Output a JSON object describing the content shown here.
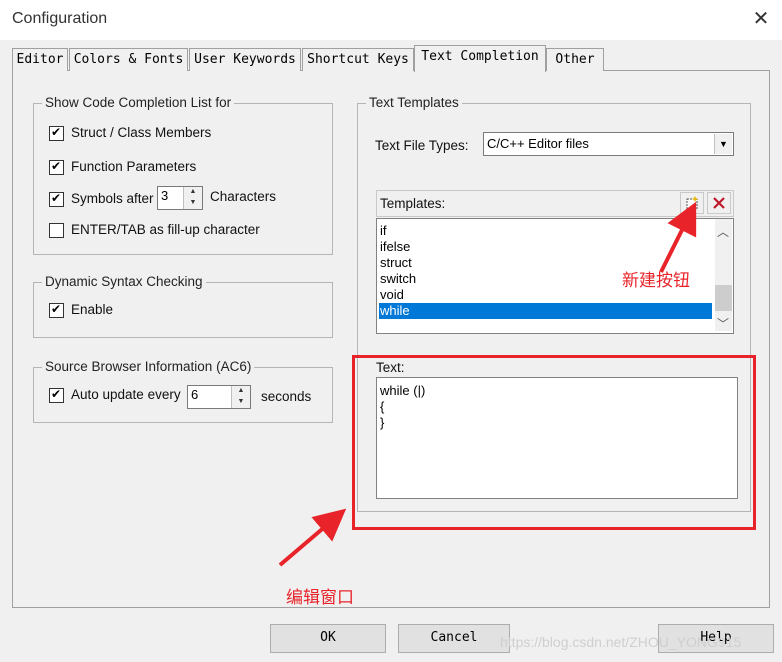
{
  "window": {
    "title": "Configuration",
    "close_glyph": "✕"
  },
  "tabs": [
    {
      "label": "Editor"
    },
    {
      "label": "Colors & Fonts"
    },
    {
      "label": "User Keywords"
    },
    {
      "label": "Shortcut Keys"
    },
    {
      "label": "Text Completion",
      "active": true
    },
    {
      "label": "Other"
    }
  ],
  "code_completion": {
    "legend": "Show Code Completion List for",
    "struct_members": {
      "label": "Struct / Class Members",
      "checked": true
    },
    "function_params": {
      "label": "Function Parameters",
      "checked": true
    },
    "symbols_after": {
      "label": "Symbols after",
      "value": "3",
      "suffix": "Characters",
      "checked": true
    },
    "enter_tab": {
      "label": "ENTER/TAB as fill-up character",
      "checked": false
    }
  },
  "syntax_checking": {
    "legend": "Dynamic Syntax Checking",
    "enable": {
      "label": "Enable",
      "checked": true
    }
  },
  "source_browser": {
    "legend": "Source Browser Information (AC6)",
    "auto_update": {
      "label": "Auto update every",
      "value": "6",
      "suffix": "seconds",
      "checked": true
    }
  },
  "text_templates": {
    "legend": "Text Templates",
    "file_types_label": "Text File Types:",
    "file_types_value": "C/C++ Editor files",
    "templates_label": "Templates:",
    "items": [
      "if",
      "ifelse",
      "struct",
      "switch",
      "void",
      "while"
    ],
    "selected": "while",
    "text_label": "Text:",
    "text_lines": [
      "while (|)",
      "{",
      "}"
    ],
    "new_icon": "new-template-icon",
    "delete_icon": "delete-template-icon"
  },
  "buttons": {
    "ok": "OK",
    "cancel": "Cancel",
    "help": "Help"
  },
  "annotations": {
    "new_button": "新建按钮",
    "edit_window": "编辑窗口"
  },
  "watermark": "https://blog.csdn.net/ZHOU_YONG915",
  "colors": {
    "annotation_red": "#e8242a",
    "selection_blue": "#0078d7"
  }
}
